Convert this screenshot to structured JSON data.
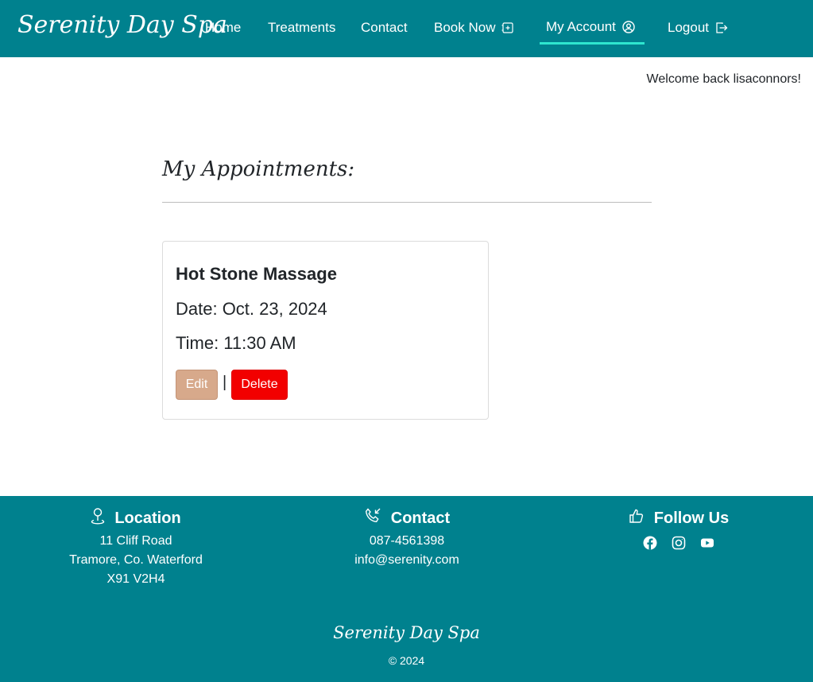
{
  "navbar": {
    "brand": "Serenity Day Spa",
    "items": [
      {
        "label": "Home"
      },
      {
        "label": "Treatments"
      },
      {
        "label": "Contact"
      },
      {
        "label": "Book Now",
        "icon": "calendar-plus-icon"
      },
      {
        "label": "My Account",
        "icon": "user-circle-icon",
        "active": true
      },
      {
        "label": "Logout",
        "icon": "logout-icon"
      }
    ],
    "background": "#00818e",
    "active_underline": "#2ee6cf"
  },
  "welcome": "Welcome back lisaconnors!",
  "page": {
    "title": "My Appointments:"
  },
  "appointment": {
    "treatment": "Hot Stone Massage",
    "date": "Date: Oct. 23, 2024",
    "time": "Time: 11:30 AM",
    "edit_label": "Edit",
    "separator": "|",
    "delete_label": "Delete",
    "edit_color": "#d7a98b",
    "delete_color": "#f20000"
  },
  "footer": {
    "location": {
      "heading": "Location",
      "icon": "map-pin-icon",
      "lines": [
        "11 Cliff Road",
        "Tramore, Co. Waterford",
        "X91 V2H4"
      ]
    },
    "contact": {
      "heading": "Contact",
      "icon": "phone-icon",
      "lines": [
        "087-4561398",
        "info@serenity.com"
      ]
    },
    "follow": {
      "heading": "Follow Us",
      "icon": "thumbs-up-icon",
      "socials": [
        "facebook-icon",
        "instagram-icon",
        "youtube-icon"
      ]
    },
    "brand": "Serenity Day Spa",
    "copyright": "© 2024"
  }
}
